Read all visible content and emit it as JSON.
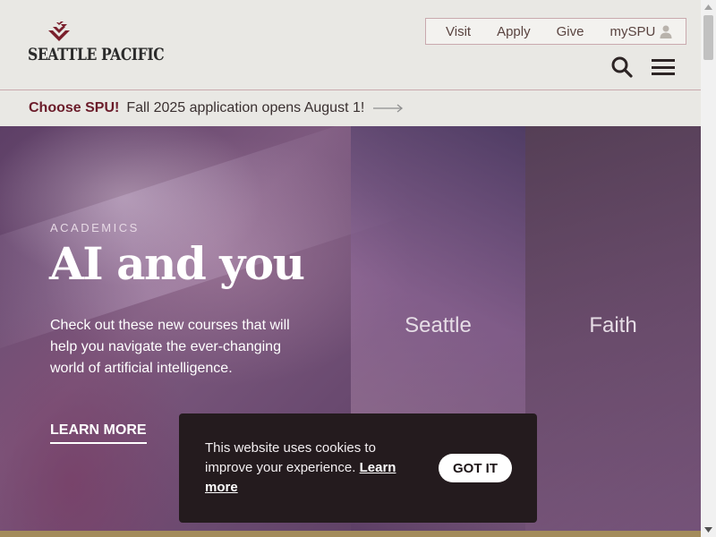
{
  "header": {
    "logo_text": "SEATTLE PACIFIC",
    "utility_nav": [
      {
        "label": "Visit"
      },
      {
        "label": "Apply"
      },
      {
        "label": "Give"
      },
      {
        "label": "mySPU",
        "icon": "person-icon"
      }
    ],
    "icons": {
      "search": "search-icon",
      "menu": "hamburger-menu-icon"
    }
  },
  "announcement": {
    "emphasis": "Choose SPU!",
    "message": "Fall 2025 application opens August 1!",
    "icon": "arrow-right-icon"
  },
  "hero": {
    "eyebrow": "ACADEMICS",
    "headline": "AI and you",
    "body": "Check out these new courses that will help you navigate the ever-changing world of artificial intelligence.",
    "cta": "LEARN MORE",
    "panels": [
      {
        "label": "Seattle"
      },
      {
        "label": "Faith"
      }
    ]
  },
  "cookie_banner": {
    "text": "This website uses cookies to improve your experience. ",
    "link": "Learn more",
    "button": "GOT IT"
  },
  "colors": {
    "brand_maroon": "#6b1c2a",
    "header_bg": "#e9e8e4",
    "cookie_bg": "#241b1e",
    "gold_strip": "#a38b5a"
  }
}
